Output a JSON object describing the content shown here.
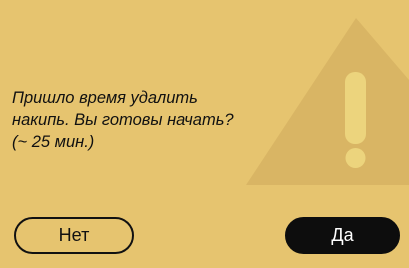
{
  "dialog": {
    "message_lines": [
      "Пришло время удалить",
      "накипь. Вы готовы начать?",
      "(~ 25 мин.)"
    ],
    "no_label": "Нет",
    "yes_label": "Да"
  },
  "icons": {
    "background_icon": "warning-triangle-icon"
  },
  "colors": {
    "background": "#e6c46f",
    "triangle": "#d9b564",
    "exclamation": "#ecd47d",
    "button_dark": "#0d0d0d"
  }
}
